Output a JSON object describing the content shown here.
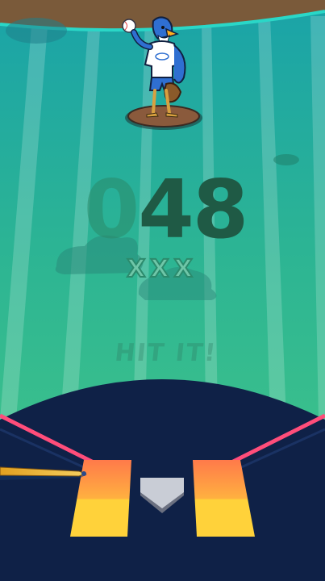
{
  "score": {
    "display": "048",
    "leading_digit": "0",
    "main_digits": "48"
  },
  "strikes": {
    "marks": [
      "X",
      "X",
      "X"
    ],
    "count": 3
  },
  "hint": {
    "text": "HIT IT!"
  },
  "colors": {
    "field_top": "#1f9fa0",
    "field_bottom": "#3cc486",
    "dirt": "#0f2147",
    "batter_box_top": "#ff7a4a",
    "batter_box_bottom": "#ffd23a",
    "foul_line": "#ff4d7a",
    "home_plate": "#c9cdd6",
    "mound": "#8a5a3c"
  },
  "characters": {
    "pitcher": "blue-jay-pitcher-mascot",
    "bat": "baseball-bat"
  }
}
